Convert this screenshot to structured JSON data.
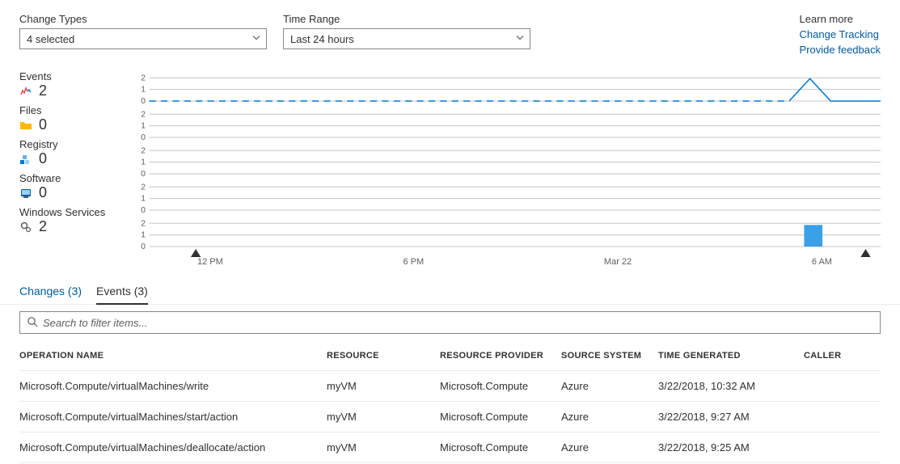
{
  "filters": {
    "change_types": {
      "label": "Change Types",
      "value": "4 selected"
    },
    "time_range": {
      "label": "Time Range",
      "value": "Last 24 hours"
    }
  },
  "learn_more": {
    "heading": "Learn more",
    "link_tracking": "Change Tracking",
    "link_feedback": "Provide feedback"
  },
  "metrics": {
    "events": {
      "label": "Events",
      "value": "2"
    },
    "files": {
      "label": "Files",
      "value": "0"
    },
    "registry": {
      "label": "Registry",
      "value": "0"
    },
    "software": {
      "label": "Software",
      "value": "0"
    },
    "winsvc": {
      "label": "Windows Services",
      "value": "2"
    }
  },
  "chart_data": [
    {
      "type": "line",
      "title": "Events",
      "ylim": [
        0,
        2
      ],
      "ticks": [
        0,
        1,
        2
      ],
      "values_estimate": "flat 0 with spike to ~2 near end"
    },
    {
      "type": "line",
      "title": "Files",
      "ylim": [
        0,
        2
      ],
      "ticks": [
        0,
        1,
        2
      ],
      "values_estimate": "flat 0"
    },
    {
      "type": "line",
      "title": "Registry",
      "ylim": [
        0,
        2
      ],
      "ticks": [
        0,
        1,
        2
      ],
      "values_estimate": "flat 0"
    },
    {
      "type": "line",
      "title": "Software",
      "ylim": [
        0,
        2
      ],
      "ticks": [
        0,
        1,
        2
      ],
      "values_estimate": "flat 0"
    },
    {
      "type": "bar",
      "title": "Windows Services",
      "ylim": [
        0,
        2
      ],
      "ticks": [
        0,
        1,
        2
      ],
      "values_estimate": "single bar ≈2 near end"
    }
  ],
  "time_axis": [
    "12 PM",
    "6 PM",
    "Mar 22",
    "6 AM"
  ],
  "tabs": {
    "changes": "Changes (3)",
    "events": "Events (3)"
  },
  "search": {
    "placeholder": "Search to filter items..."
  },
  "table": {
    "headers": {
      "op": "OPERATION NAME",
      "res": "RESOURCE",
      "provider": "RESOURCE PROVIDER",
      "source": "SOURCE SYSTEM",
      "time": "TIME GENERATED",
      "caller": "CALLER"
    },
    "rows": [
      {
        "op": "Microsoft.Compute/virtualMachines/write",
        "res": "myVM",
        "provider": "Microsoft.Compute",
        "source": "Azure",
        "time": "3/22/2018, 10:32 AM",
        "caller": ""
      },
      {
        "op": "Microsoft.Compute/virtualMachines/start/action",
        "res": "myVM",
        "provider": "Microsoft.Compute",
        "source": "Azure",
        "time": "3/22/2018, 9:27 AM",
        "caller": ""
      },
      {
        "op": "Microsoft.Compute/virtualMachines/deallocate/action",
        "res": "myVM",
        "provider": "Microsoft.Compute",
        "source": "Azure",
        "time": "3/22/2018, 9:25 AM",
        "caller": ""
      }
    ]
  },
  "colors": {
    "accent": "#0078d4",
    "link": "#005a9e"
  }
}
